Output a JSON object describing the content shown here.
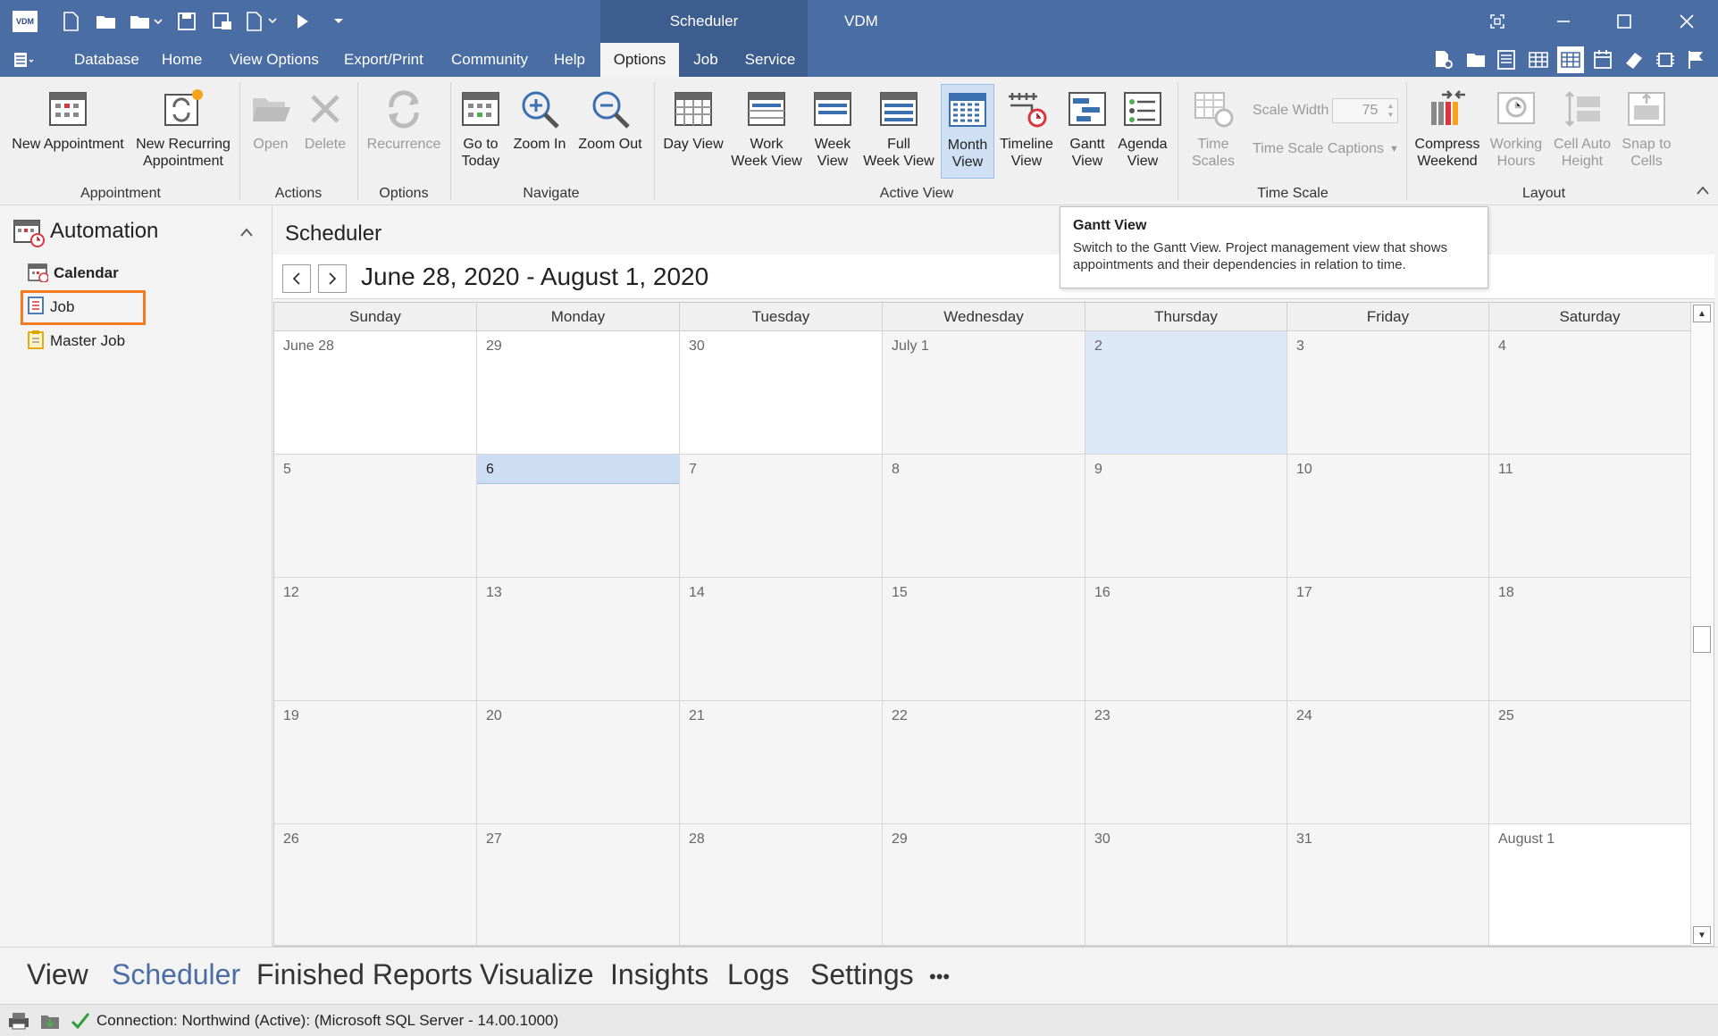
{
  "titlebar": {
    "logo": "VDM",
    "context_tab_title": "Scheduler",
    "app_title": "VDM"
  },
  "ribbon_tabs": [
    {
      "label": "Database"
    },
    {
      "label": "Home"
    },
    {
      "label": "View Options"
    },
    {
      "label": "Export/Print"
    },
    {
      "label": "Community"
    },
    {
      "label": "Help"
    },
    {
      "label": "Options"
    },
    {
      "label": "Job"
    },
    {
      "label": "Service"
    }
  ],
  "ribbon": {
    "groups": {
      "appointment": "Appointment",
      "actions": "Actions",
      "options": "Options",
      "navigate": "Navigate",
      "active_view": "Active View",
      "time_scale": "Time Scale",
      "layout": "Layout"
    },
    "buttons": {
      "new_appointment": "New Appointment",
      "new_recurring_1": "New Recurring",
      "new_recurring_2": "Appointment",
      "open": "Open",
      "delete": "Delete",
      "recurrence": "Recurrence",
      "go_to_today_1": "Go to",
      "go_to_today_2": "Today",
      "zoom_in": "Zoom In",
      "zoom_out": "Zoom Out",
      "day_view": "Day View",
      "work_week_1": "Work",
      "work_week_2": "Week View",
      "week_1": "Week",
      "week_2": "View",
      "full_week_1": "Full",
      "full_week_2": "Week View",
      "month_1": "Month",
      "month_2": "View",
      "timeline_1": "Timeline",
      "timeline_2": "View",
      "gantt_1": "Gantt",
      "gantt_2": "View",
      "agenda_1": "Agenda",
      "agenda_2": "View",
      "time_scales_1": "Time",
      "time_scales_2": "Scales",
      "scale_width_label": "Scale Width",
      "scale_width_value": "75",
      "time_scale_captions": "Time Scale Captions",
      "compress_1": "Compress",
      "compress_2": "Weekend",
      "working_1": "Working",
      "working_2": "Hours",
      "cell_auto_1": "Cell Auto",
      "cell_auto_2": "Height",
      "snap_1": "Snap to",
      "snap_2": "Cells"
    }
  },
  "sidebar": {
    "title": "Automation",
    "items": [
      {
        "label": "Calendar"
      },
      {
        "label": "Job"
      },
      {
        "label": "Master Job"
      }
    ]
  },
  "scheduler": {
    "title": "Scheduler",
    "range": "June 28, 2020 - August 1, 2020",
    "day_headers": [
      "Sunday",
      "Monday",
      "Tuesday",
      "Wednesday",
      "Thursday",
      "Friday",
      "Saturday"
    ],
    "weeks": [
      [
        "June 28",
        "29",
        "30",
        "July 1",
        "2",
        "3",
        "4"
      ],
      [
        "5",
        "6",
        "7",
        "8",
        "9",
        "10",
        "11"
      ],
      [
        "12",
        "13",
        "14",
        "15",
        "16",
        "17",
        "18"
      ],
      [
        "19",
        "20",
        "21",
        "22",
        "23",
        "24",
        "25"
      ],
      [
        "26",
        "27",
        "28",
        "29",
        "30",
        "31",
        "August 1"
      ]
    ]
  },
  "tooltip": {
    "title": "Gantt View",
    "body": "Switch to the Gantt View. Project management view that shows appointments and their dependencies in relation to time."
  },
  "bottom_nav": [
    {
      "label": "View"
    },
    {
      "label": "Scheduler"
    },
    {
      "label": "Finished Reports"
    },
    {
      "label": "Visualize"
    },
    {
      "label": "Insights"
    },
    {
      "label": "Logs"
    },
    {
      "label": "Settings"
    },
    {
      "label": "•••"
    }
  ],
  "status": {
    "connection": "Connection: Northwind (Active): (Microsoft SQL Server - 14.00.1000)"
  },
  "colors": {
    "accent": "#4a6da3",
    "today": "#dce8f8",
    "selection": "#cdddf4",
    "highlight_border": "#f47b20"
  }
}
